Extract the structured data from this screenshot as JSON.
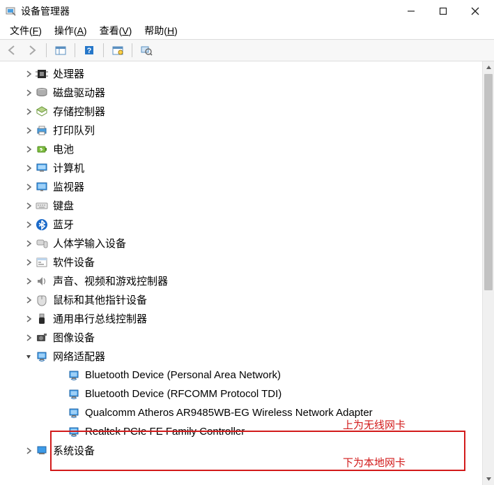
{
  "window": {
    "title": "设备管理器"
  },
  "menu": {
    "file": {
      "label": "文件",
      "accel": "F"
    },
    "action": {
      "label": "操作",
      "accel": "A"
    },
    "view": {
      "label": "查看",
      "accel": "V"
    },
    "help": {
      "label": "帮助",
      "accel": "H"
    }
  },
  "tree": {
    "items": [
      {
        "expand": "closed",
        "icon": "cpu",
        "label": "处理器"
      },
      {
        "expand": "closed",
        "icon": "disk",
        "label": "磁盘驱动器"
      },
      {
        "expand": "closed",
        "icon": "storage",
        "label": "存储控制器"
      },
      {
        "expand": "closed",
        "icon": "printer",
        "label": "打印队列"
      },
      {
        "expand": "closed",
        "icon": "battery",
        "label": "电池"
      },
      {
        "expand": "closed",
        "icon": "computer",
        "label": "计算机"
      },
      {
        "expand": "closed",
        "icon": "monitor",
        "label": "监视器"
      },
      {
        "expand": "closed",
        "icon": "keyboard",
        "label": "键盘"
      },
      {
        "expand": "closed",
        "icon": "bt",
        "label": "蓝牙"
      },
      {
        "expand": "closed",
        "icon": "hid",
        "label": "人体学输入设备"
      },
      {
        "expand": "closed",
        "icon": "software",
        "label": "软件设备"
      },
      {
        "expand": "closed",
        "icon": "audio",
        "label": "声音、视频和游戏控制器"
      },
      {
        "expand": "closed",
        "icon": "mouse",
        "label": "鼠标和其他指针设备"
      },
      {
        "expand": "closed",
        "icon": "usb",
        "label": "通用串行总线控制器"
      },
      {
        "expand": "closed",
        "icon": "image",
        "label": "图像设备"
      },
      {
        "expand": "open",
        "icon": "network",
        "label": "网络适配器",
        "children": [
          {
            "icon": "nic",
            "label": "Bluetooth Device (Personal Area Network)"
          },
          {
            "icon": "nic",
            "label": "Bluetooth Device (RFCOMM Protocol TDI)"
          },
          {
            "icon": "nic",
            "label": "Qualcomm Atheros AR9485WB-EG Wireless Network Adapter"
          },
          {
            "icon": "nic",
            "label": "Realtek PCIe FE Family Controller"
          }
        ]
      },
      {
        "expand": "closed",
        "icon": "system",
        "label": "系统设备"
      }
    ]
  },
  "annotations": {
    "top": "上为无线网卡",
    "bottom": "下为本地网卡"
  }
}
